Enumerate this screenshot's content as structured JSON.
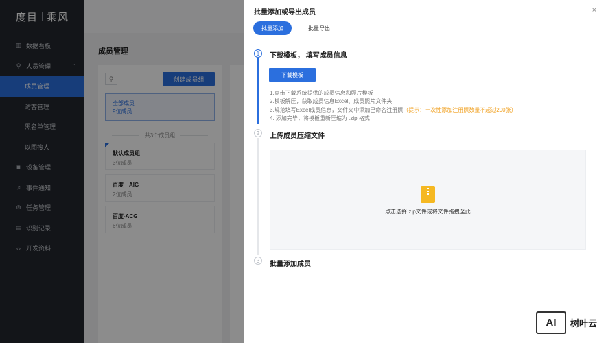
{
  "sidebar": {
    "logo_left": "度目",
    "logo_right": "乘风",
    "items": [
      {
        "label": "数据看板",
        "icon": "bar-chart-icon",
        "sub": false,
        "active": false,
        "chev": false
      },
      {
        "label": "人员管理",
        "icon": "person-icon",
        "sub": false,
        "active": false,
        "chev": true
      },
      {
        "label": "成员管理",
        "icon": "",
        "sub": true,
        "active": true,
        "chev": false
      },
      {
        "label": "访客管理",
        "icon": "",
        "sub": true,
        "active": false,
        "chev": false
      },
      {
        "label": "黑名单管理",
        "icon": "",
        "sub": true,
        "active": false,
        "chev": false
      },
      {
        "label": "以图搜人",
        "icon": "",
        "sub": true,
        "active": false,
        "chev": false
      },
      {
        "label": "设备管理",
        "icon": "device-icon",
        "sub": false,
        "active": false,
        "chev": false
      },
      {
        "label": "事件通知",
        "icon": "bell-icon",
        "sub": false,
        "active": false,
        "chev": false
      },
      {
        "label": "任务管理",
        "icon": "task-icon",
        "sub": false,
        "active": false,
        "chev": false
      },
      {
        "label": "识别记录",
        "icon": "record-icon",
        "sub": false,
        "active": false,
        "chev": false
      },
      {
        "label": "开发资料",
        "icon": "code-icon",
        "sub": false,
        "active": false,
        "chev": false
      }
    ]
  },
  "main": {
    "page_title": "成员管理",
    "create_group_label": "创建成员组",
    "all_members_title": "全部成员",
    "all_members_count": "9位成员",
    "group_count_text": "共3个成员组",
    "groups": [
      {
        "name": "默认成员组",
        "count": "3位成员"
      },
      {
        "name": "百度—AIG",
        "count": "2位成员"
      },
      {
        "name": "百度-ACG",
        "count": "6位成员"
      }
    ]
  },
  "drawer": {
    "title": "批量添加或导出成员",
    "close_symbol": "×",
    "tabs": [
      "批量添加",
      "批量导出"
    ],
    "steps": [
      {
        "num": "1",
        "title": "下载模板， 填写成员信息"
      },
      {
        "num": "2",
        "title": "上传成员压缩文件"
      },
      {
        "num": "3",
        "title": "批量添加成员"
      }
    ],
    "download_label": "下载模板",
    "tips": [
      "1.点击下载系统提供的成员信息和照片模板",
      "2.模板解压，获取成员信息Excel、成员照片文件夹",
      "3.规范填写Excel成员信息，文件夹中添加已命名注册照",
      "4. 添加完毕，将模板重新压缩为 .zip 格式"
    ],
    "tip_warning": "（提示：一次性添加注册照数量不超过200张）",
    "upload_text": "点击选择.zip文件或将文件拖拽至此"
  },
  "watermark": {
    "box_text": "AI",
    "text": "树叶云"
  },
  "colors": {
    "primary": "#2b6fde",
    "sidebar_bg": "#23272f",
    "warning": "#f0a020",
    "zip_icon": "#f5b822"
  }
}
